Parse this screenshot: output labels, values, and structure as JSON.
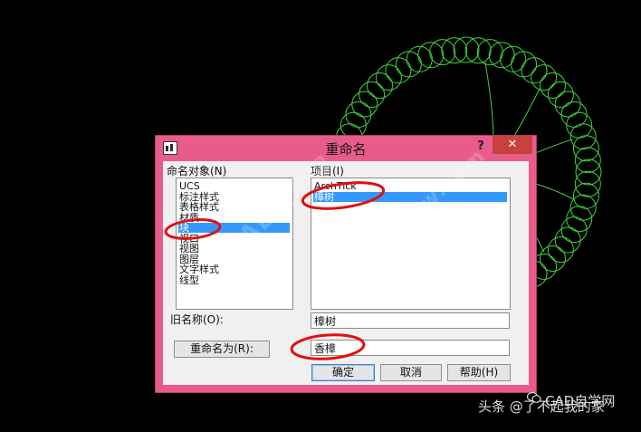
{
  "dialog": {
    "title": "重命名",
    "help_symbol": "?",
    "close_symbol": "✕"
  },
  "named_objects": {
    "label": "命名对象(N)",
    "items": [
      "UCS",
      "标注样式",
      "表格样式",
      "材质",
      "块",
      "视口",
      "视图",
      "图层",
      "文字样式",
      "线型"
    ],
    "selected_index": 4
  },
  "items_list": {
    "label": "项目(I)",
    "items": [
      "ArchTick",
      "樟树"
    ],
    "selected_index": 1
  },
  "old_name": {
    "label": "旧名称(O):",
    "value": "樟树"
  },
  "rename_to": {
    "button_label": "重命名为(R):",
    "value": "香樟"
  },
  "buttons": {
    "ok": "确定",
    "cancel": "取消",
    "help": "帮助(H)"
  },
  "watermarks": {
    "left": "CAD自学网",
    "right": "www.cadzxw.com"
  },
  "footer": {
    "credit": "头条 @了不起我的家",
    "brand": "CAD自学网"
  },
  "colors": {
    "dialog_frame": "#e85c8c",
    "cad_lines": "#3fd43f",
    "annotation_ink": "#e01010",
    "selection": "#3399ff"
  }
}
